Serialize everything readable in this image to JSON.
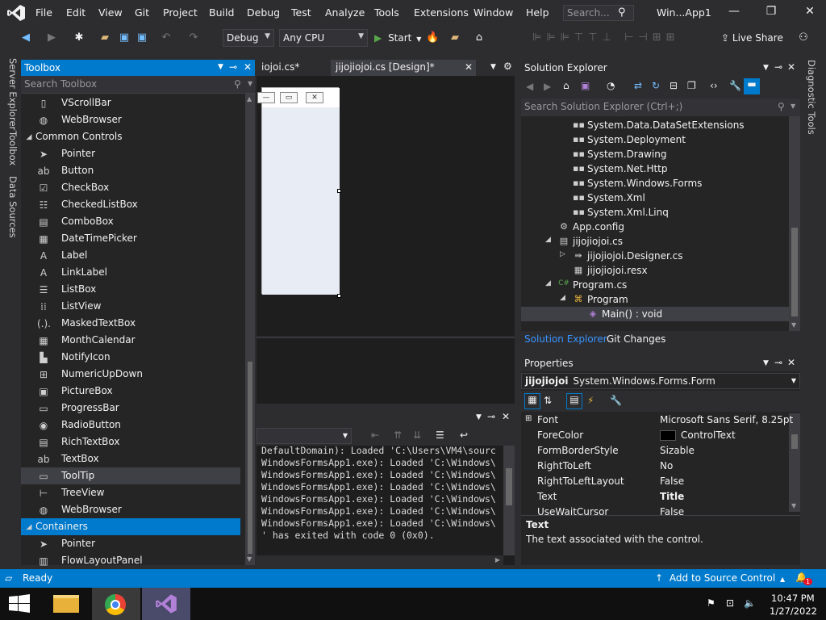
{
  "menu": [
    "File",
    "Edit",
    "View",
    "Git",
    "Project",
    "Build",
    "Debug",
    "Test",
    "Analyze",
    "Tools",
    "Extensions",
    "Window",
    "Help"
  ],
  "search": {
    "placeholder": "Search..."
  },
  "window_title": "Win...App1",
  "toolbar": {
    "config": "Debug",
    "platform": "Any CPU",
    "start_label": "Start",
    "live_share": "Live Share"
  },
  "side_tabs": {
    "server_explorer": "Server Explorer",
    "toolbox": "Toolbox",
    "data_sources": "Data Sources",
    "diagnostic_tools": "Diagnostic Tools"
  },
  "toolbox": {
    "title": "Toolbox",
    "search_placeholder": "Search Toolbox",
    "items": [
      {
        "label": "VScrollBar",
        "icon": "vscrollbar-icon",
        "glyph": "▯"
      },
      {
        "label": "WebBrowser",
        "icon": "webbrowser-icon",
        "glyph": "◍"
      },
      {
        "label": "Common Controls",
        "group": true
      },
      {
        "label": "Pointer",
        "icon": "pointer-icon",
        "glyph": "➤"
      },
      {
        "label": "Button",
        "icon": "button-icon",
        "glyph": "ab"
      },
      {
        "label": "CheckBox",
        "icon": "checkbox-icon",
        "glyph": "☑"
      },
      {
        "label": "CheckedListBox",
        "icon": "checkedlistbox-icon",
        "glyph": "☷"
      },
      {
        "label": "ComboBox",
        "icon": "combobox-icon",
        "glyph": "▤"
      },
      {
        "label": "DateTimePicker",
        "icon": "datetimepicker-icon",
        "glyph": "▦"
      },
      {
        "label": "Label",
        "icon": "label-icon",
        "glyph": "A"
      },
      {
        "label": "LinkLabel",
        "icon": "linklabel-icon",
        "glyph": "A"
      },
      {
        "label": "ListBox",
        "icon": "listbox-icon",
        "glyph": "☰"
      },
      {
        "label": "ListView",
        "icon": "listview-icon",
        "glyph": "⁞⁞"
      },
      {
        "label": "MaskedTextBox",
        "icon": "maskedtextbox-icon",
        "glyph": "(.)."
      },
      {
        "label": "MonthCalendar",
        "icon": "monthcalendar-icon",
        "glyph": "▦"
      },
      {
        "label": "NotifyIcon",
        "icon": "notifyicon-icon",
        "glyph": "▙"
      },
      {
        "label": "NumericUpDown",
        "icon": "numericupdown-icon",
        "glyph": "⊞"
      },
      {
        "label": "PictureBox",
        "icon": "picturebox-icon",
        "glyph": "▣"
      },
      {
        "label": "ProgressBar",
        "icon": "progressbar-icon",
        "glyph": "▭"
      },
      {
        "label": "RadioButton",
        "icon": "radiobutton-icon",
        "glyph": "◉"
      },
      {
        "label": "RichTextBox",
        "icon": "richtextbox-icon",
        "glyph": "▤"
      },
      {
        "label": "TextBox",
        "icon": "textbox-icon",
        "glyph": "ab"
      },
      {
        "label": "ToolTip",
        "icon": "tooltip-icon",
        "glyph": "▭",
        "selected": true
      },
      {
        "label": "TreeView",
        "icon": "treeview-icon",
        "glyph": "⊢"
      },
      {
        "label": "WebBrowser",
        "icon": "webbrowser-icon",
        "glyph": "◍"
      },
      {
        "label": "Containers",
        "group": true,
        "active": true
      },
      {
        "label": "Pointer",
        "icon": "pointer-icon",
        "glyph": "➤"
      },
      {
        "label": "FlowLayoutPanel",
        "icon": "flowlayoutpanel-icon",
        "glyph": "▥"
      }
    ]
  },
  "doc_tabs": [
    {
      "label": "iojoi.cs*"
    },
    {
      "label": "jijojiojoi.cs [Design]*"
    }
  ],
  "output": {
    "lines": [
      "DefaultDomain): Loaded 'C:\\Users\\VM4\\sourc",
      "WindowsFormsApp1.exe): Loaded 'C:\\Windows\\",
      "WindowsFormsApp1.exe): Loaded 'C:\\Windows\\",
      "WindowsFormsApp1.exe): Loaded 'C:\\Windows\\",
      "WindowsFormsApp1.exe): Loaded 'C:\\Windows\\",
      "WindowsFormsApp1.exe): Loaded 'C:\\Windows\\",
      "WindowsFormsApp1.exe): Loaded 'C:\\Windows\\",
      "' has exited with code 0 (0x0)."
    ]
  },
  "solution_explorer": {
    "title": "Solution Explorer",
    "search_placeholder": "Search Solution Explorer (Ctrl+;)",
    "tree": [
      {
        "label": "System.Data.DataSetExtensions",
        "level": 3,
        "icon": "reference-icon"
      },
      {
        "label": "System.Deployment",
        "level": 3,
        "icon": "reference-icon"
      },
      {
        "label": "System.Drawing",
        "level": 3,
        "icon": "reference-icon"
      },
      {
        "label": "System.Net.Http",
        "level": 3,
        "icon": "reference-icon"
      },
      {
        "label": "System.Windows.Forms",
        "level": 3,
        "icon": "reference-icon"
      },
      {
        "label": "System.Xml",
        "level": 3,
        "icon": "reference-icon"
      },
      {
        "label": "System.Xml.Linq",
        "level": 3,
        "icon": "reference-icon"
      },
      {
        "label": "App.config",
        "level": 2,
        "icon": "config-file-icon"
      },
      {
        "label": "jijojiojoi.cs",
        "level": 2,
        "icon": "form-file-icon",
        "expanded": true
      },
      {
        "label": "jijojiojoi.Designer.cs",
        "level": 3,
        "icon": "csharp-file-icon",
        "collapsed": true
      },
      {
        "label": "jijojiojoi.resx",
        "level": 3,
        "icon": "resx-file-icon"
      },
      {
        "label": "Program.cs",
        "level": 2,
        "icon": "csharp-icon",
        "expanded": true
      },
      {
        "label": "Program",
        "level": 3,
        "icon": "class-icon",
        "expanded": true
      },
      {
        "label": "Main() : void",
        "level": 4,
        "icon": "method-icon",
        "selected": true
      }
    ],
    "tabs": [
      "Solution Explorer",
      "Git Changes"
    ]
  },
  "properties": {
    "title": "Properties",
    "object_name": "jijojiojoi",
    "object_type": "System.Windows.Forms.Form",
    "rows": [
      {
        "name": "Font",
        "value": "Microsoft Sans Serif, 8.25pt",
        "expandable": true
      },
      {
        "name": "ForeColor",
        "value": "ControlText",
        "swatch": "#000000"
      },
      {
        "name": "FormBorderStyle",
        "value": "Sizable"
      },
      {
        "name": "RightToLeft",
        "value": "No"
      },
      {
        "name": "RightToLeftLayout",
        "value": "False"
      },
      {
        "name": "Text",
        "value": "Title",
        "bold": true
      },
      {
        "name": "UseWaitCursor",
        "value": "False"
      }
    ],
    "desc_title": "Text",
    "desc_text": "The text associated with the control."
  },
  "status": {
    "ready": "Ready",
    "source_control": "Add to Source Control",
    "notifications": "1"
  },
  "taskbar": {
    "time": "10:47 PM",
    "date": "1/27/2022"
  },
  "colors": {
    "accent": "#007acc",
    "background": "#2d2d30",
    "panel": "#252526",
    "editor": "#1e1e1e"
  }
}
